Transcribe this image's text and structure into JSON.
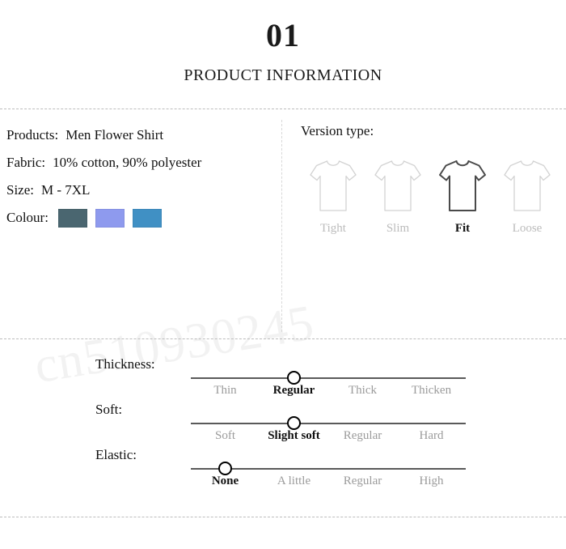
{
  "watermark": {
    "text": "cn510930245"
  },
  "header": {
    "number": "01",
    "title": "PRODUCT INFORMATION"
  },
  "product_info": {
    "rows": [
      {
        "label": "Products:",
        "value": "Men Flower Shirt"
      },
      {
        "label": "Fabric:",
        "value": "10% cotton, 90% polyester"
      },
      {
        "label": "Size:",
        "value": "M - 7XL"
      }
    ],
    "colour": {
      "label": "Colour:",
      "swatches": [
        {
          "name": "dark-slate-blue",
          "hex": "#4a6670"
        },
        {
          "name": "periwinkle",
          "hex": "#8e9aee"
        },
        {
          "name": "medium-blue",
          "hex": "#4090c4"
        }
      ]
    }
  },
  "version_type": {
    "heading": "Version type:",
    "selected": "Fit",
    "options": [
      {
        "label": "Tight",
        "selected": false
      },
      {
        "label": "Slim",
        "selected": false
      },
      {
        "label": "Fit",
        "selected": true
      },
      {
        "label": "Loose",
        "selected": false
      }
    ]
  },
  "sliders": [
    {
      "name": "Thickness:",
      "selected_index": 1,
      "options": [
        "Thin",
        "Regular",
        "Thick",
        "Thicken"
      ]
    },
    {
      "name": "Soft:",
      "selected_index": 1,
      "options": [
        "Soft",
        "Slight soft",
        "Regular",
        "Hard"
      ]
    },
    {
      "name": "Elastic:",
      "selected_index": 0,
      "options": [
        "None",
        "A little",
        "Regular",
        "High"
      ]
    }
  ],
  "colors": {
    "divider": "#bdbdbd",
    "track": "#5a5a5a",
    "inactive_label": "#9b9b9b",
    "shirt_inactive_stroke": "#d2d2d2",
    "shirt_active_stroke": "#4a4a4a"
  }
}
